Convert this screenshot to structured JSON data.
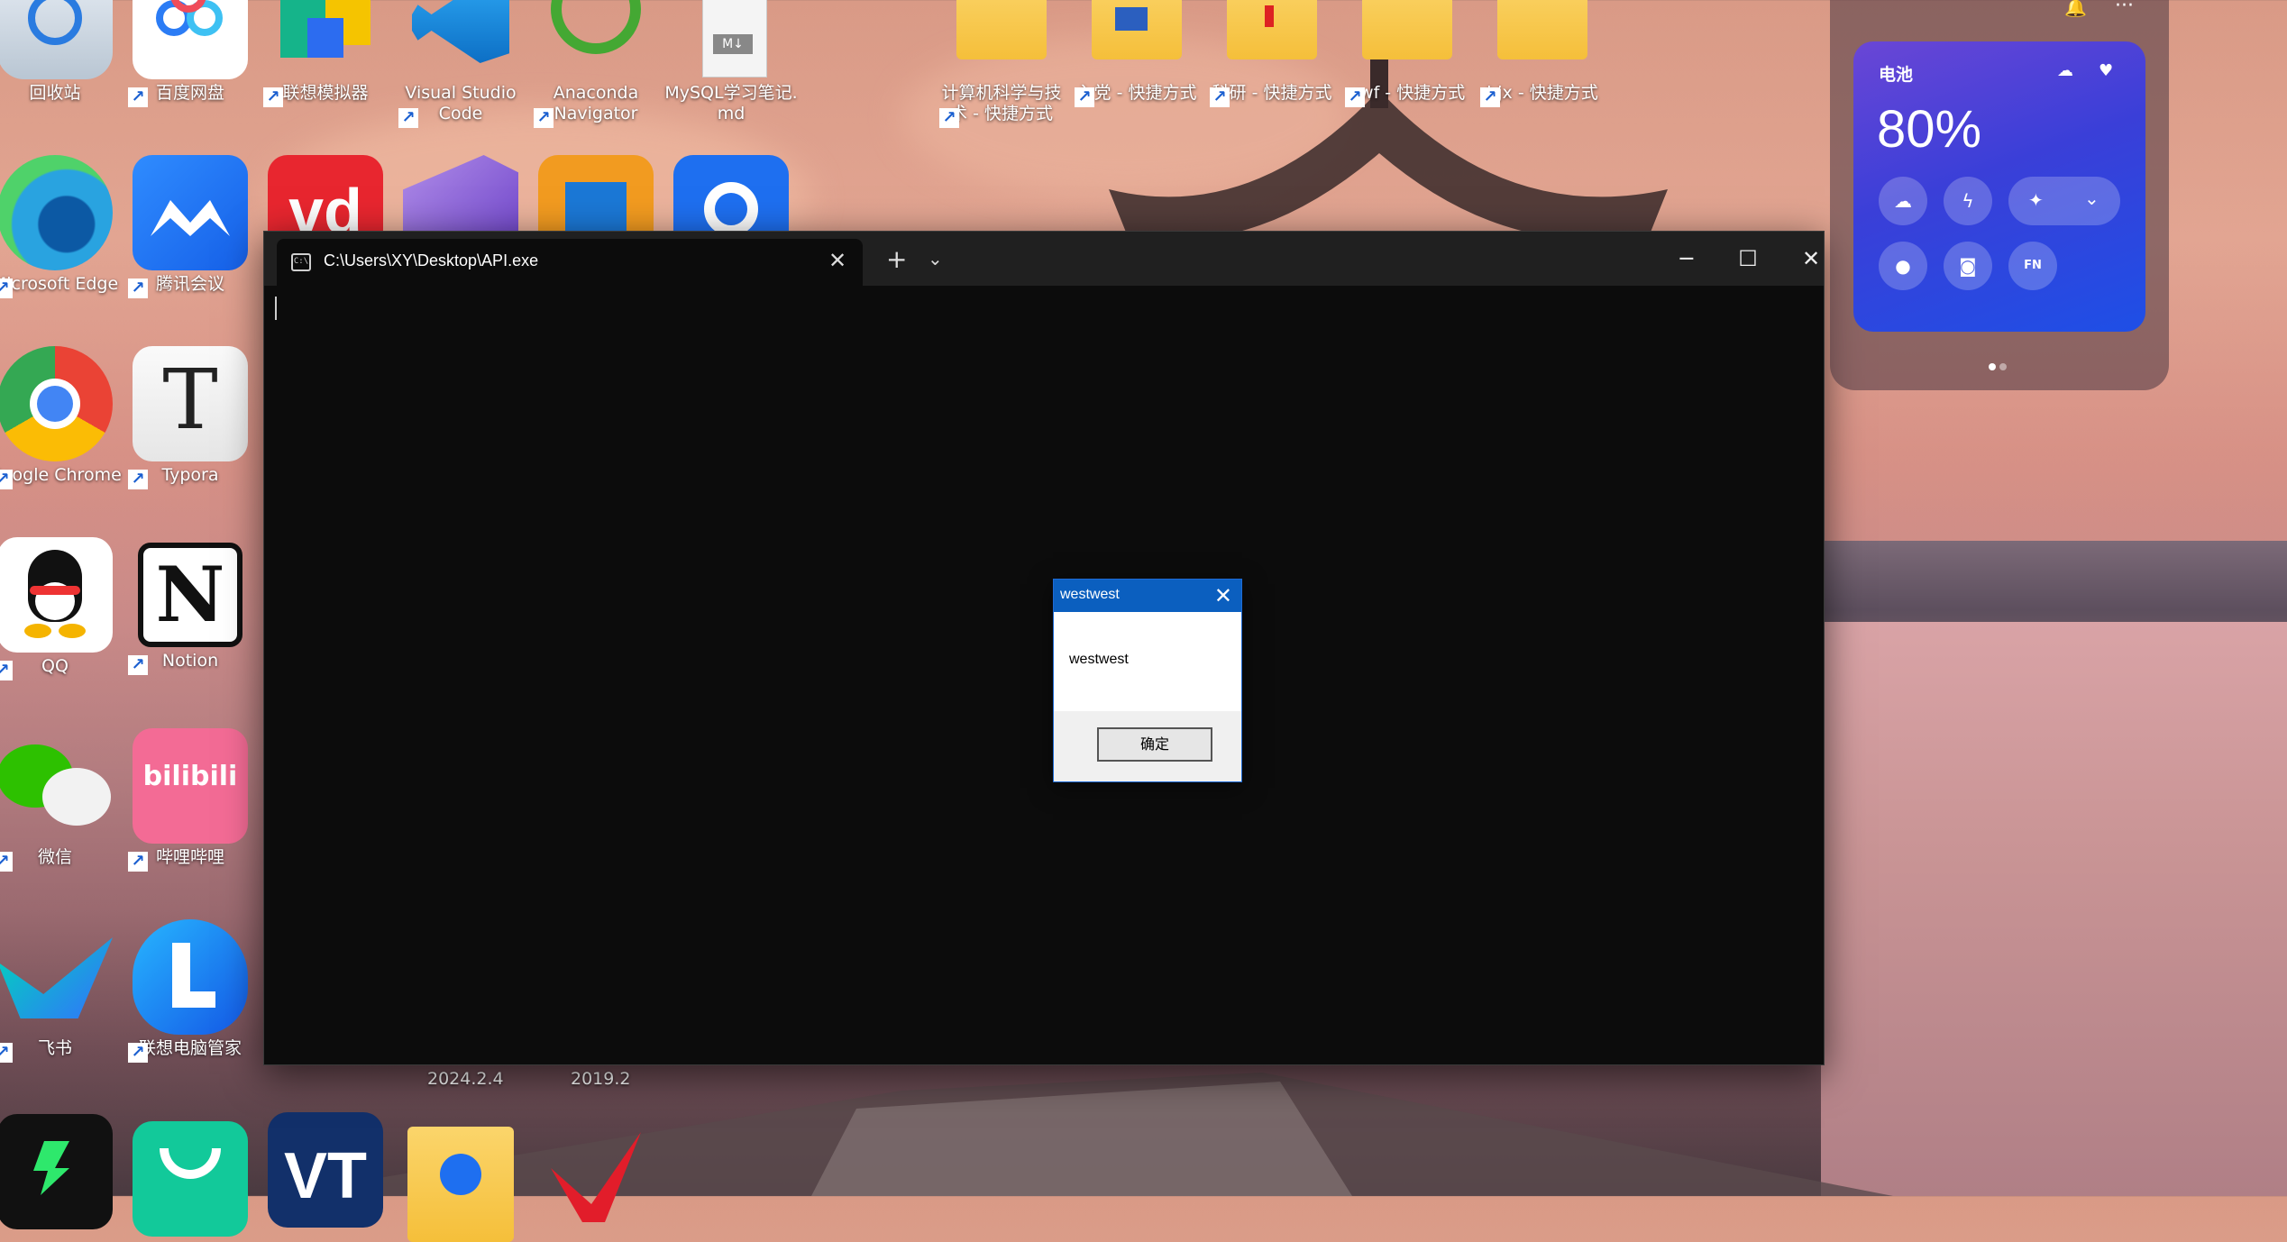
{
  "desktop": {
    "icons": [
      {
        "label": "回收站",
        "icon": "recycle-bin-icon"
      },
      {
        "label": "百度网盘",
        "icon": "baidu-netdisk-icon"
      },
      {
        "label": "联想模拟器",
        "icon": "lenovo-emulator-icon"
      },
      {
        "label": "Visual Studio Code",
        "icon": "vscode-icon"
      },
      {
        "label": "Anaconda Navigator",
        "icon": "anaconda-icon"
      },
      {
        "label": "MySQL学习笔记.md",
        "icon": "markdown-file-icon",
        "badge": "M↓"
      },
      {
        "label": "计算机科学与技术 - 快捷方式",
        "icon": "folder-icon"
      },
      {
        "label": "入党 - 快捷方式",
        "icon": "folder-icon"
      },
      {
        "label": "科研 - 快捷方式",
        "icon": "folder-icon"
      },
      {
        "label": "ywf - 快捷方式",
        "icon": "folder-icon"
      },
      {
        "label": "hjx - 快捷方式",
        "icon": "folder-icon"
      },
      {
        "label": "Microsoft Edge",
        "icon": "edge-icon"
      },
      {
        "label": "腾讯会议",
        "icon": "tencent-meeting-icon"
      },
      {
        "label": "Google Chrome",
        "icon": "chrome-icon"
      },
      {
        "label": "Typora",
        "icon": "typora-icon",
        "glyph": "T"
      },
      {
        "label": "QQ",
        "icon": "qq-icon"
      },
      {
        "label": "Notion",
        "icon": "notion-icon",
        "glyph": "N"
      },
      {
        "label": "微信",
        "icon": "wechat-icon"
      },
      {
        "label": "哔哩哔哩",
        "icon": "bilibili-icon",
        "glyph": "bilibili"
      },
      {
        "label": "飞书",
        "icon": "feishu-icon"
      },
      {
        "label": "联想电脑管家",
        "icon": "lenovo-manager-icon"
      }
    ],
    "dates": [
      "2024.2.4",
      "2019.2"
    ],
    "partial_icon_glyphs": {
      "vd": "vd",
      "vt": "VT"
    }
  },
  "terminal": {
    "tab_title": "C:\\Users\\XY\\Desktop\\API.exe",
    "tab_icon_text": "C:\\",
    "close_tab": "✕",
    "new_tab": "+",
    "dropdown": "⌄",
    "minimize": "─",
    "maximize": "☐",
    "close": "✕"
  },
  "message_box": {
    "title": "westwest",
    "message": "westwest",
    "ok_label": "确定",
    "close": "✕"
  },
  "battery_widget": {
    "label": "电池",
    "percent": "80%",
    "level": 0.8,
    "bell": "🔔",
    "more": "···",
    "fn_label": "FN"
  },
  "colors": {
    "terminal_bg": "#0c0c0c",
    "titlebar_bg": "#202020",
    "msgbox_title_bg": "#0b5fbf",
    "battery_gradient_start": "#6a46d6",
    "battery_gradient_end": "#1e4fe6"
  }
}
